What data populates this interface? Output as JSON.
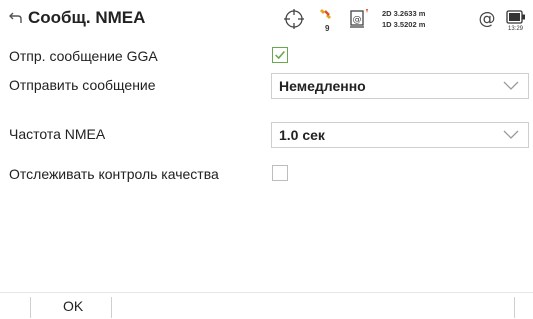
{
  "header": {
    "title": "Сообщ. NMEA",
    "satellites": "9",
    "precision_2d": "2D 3.2633 m",
    "precision_1d": "1D 3.5202 m",
    "battery_time": "13:29"
  },
  "form": {
    "gga_label": "Отпр. сообщение GGA",
    "gga_checked": true,
    "send_label": "Отправить сообщение",
    "send_value": "Немедленно",
    "freq_label": "Частота NMEA",
    "freq_value": "1.0 сек",
    "quality_label": "Отслеживать контроль качества",
    "quality_checked": false
  },
  "footer": {
    "ok_label": "OK"
  },
  "colors": {
    "check": "#6aa84f",
    "sat": "#e8a317",
    "sat_red": "#e04a2a"
  }
}
